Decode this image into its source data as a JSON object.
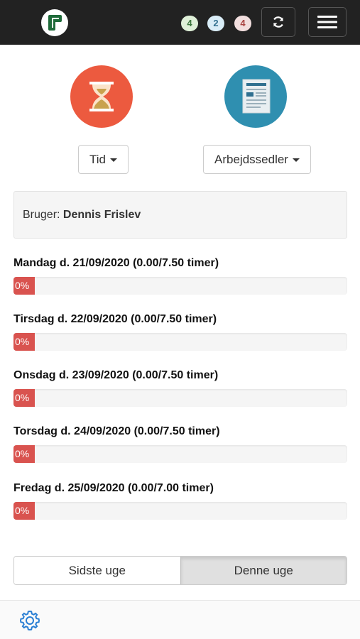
{
  "header": {
    "badges": [
      {
        "count": "4",
        "status": "success",
        "color": "#3c763d"
      },
      {
        "count": "2",
        "status": "info",
        "color": "#31708f"
      },
      {
        "count": "4",
        "status": "danger",
        "color": "#a94442"
      }
    ],
    "icons": {
      "logo": "app-logo-icon",
      "refresh": "refresh-icon",
      "menu": "hamburger-menu-icon"
    }
  },
  "apps": {
    "time": {
      "icon": "hourglass-icon",
      "color": "#ec5a3f",
      "dropdown_label": "Tid"
    },
    "worksheets": {
      "icon": "document-icon",
      "color": "#2f8fb0",
      "dropdown_label": "Arbejdssedler"
    }
  },
  "user": {
    "label": "Bruger:",
    "name": "Dennis Frislev"
  },
  "days": [
    {
      "label": "Mandag d. 21/09/2020 (0.00/7.50 timer)",
      "progress_text": "0%",
      "progress": 0
    },
    {
      "label": "Tirsdag d. 22/09/2020 (0.00/7.50 timer)",
      "progress_text": "0%",
      "progress": 0
    },
    {
      "label": "Onsdag d. 23/09/2020 (0.00/7.50 timer)",
      "progress_text": "0%",
      "progress": 0
    },
    {
      "label": "Torsdag d. 24/09/2020 (0.00/7.50 timer)",
      "progress_text": "0%",
      "progress": 0
    },
    {
      "label": "Fredag d. 25/09/2020 (0.00/7.00 timer)",
      "progress_text": "0%",
      "progress": 0
    }
  ],
  "week_toggle": {
    "previous": "Sidste uge",
    "current": "Denne uge",
    "selected": "current"
  },
  "footer": {
    "settings_icon": "gear-icon",
    "accent": "#2a7fd4"
  }
}
